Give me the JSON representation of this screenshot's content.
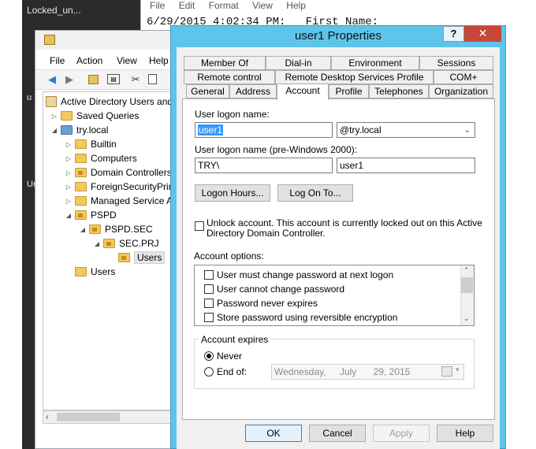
{
  "desktop": {
    "window_title": "Locked_un...",
    "letter_1": "u",
    "letter_2": "Ur"
  },
  "notepad": {
    "menu": [
      "File",
      "Edit",
      "Format",
      "View",
      "Help"
    ],
    "text": "6/29/2015 4:02:34 PM:   First Name:"
  },
  "aduc": {
    "menu": [
      "File",
      "Action",
      "View",
      "Help"
    ],
    "tree": [
      "Active Directory Users and",
      "Saved Queries",
      "try.local",
      "Builtin",
      "Computers",
      "Domain Controllers",
      "ForeignSecurityPrin",
      "Managed Service A",
      "PSPD",
      "PSPD.SEC",
      "SEC.PRJ",
      "Users",
      "Users"
    ]
  },
  "dialog": {
    "title": "user1 Properties",
    "help_glyph": "?",
    "close_glyph": "✕",
    "tabs_row1": [
      "Member Of",
      "Dial-in",
      "Environment",
      "Sessions"
    ],
    "tabs_row2": [
      "Remote control",
      "Remote Desktop Services Profile",
      "COM+"
    ],
    "tabs_row3": [
      "General",
      "Address",
      "Account",
      "Profile",
      "Telephones",
      "Organization"
    ],
    "active_tab": "Account",
    "logon_name_label": "User logon name:",
    "logon_name_value": "user1",
    "domain_suffix": "@try.local",
    "pre2000_label": "User logon name (pre-Windows 2000):",
    "pre2000_domain": "TRY\\",
    "pre2000_user": "user1",
    "logon_hours_button": "Logon Hours...",
    "logon_to_button": "Log On To...",
    "unlock_line1": "Unlock account. This account is currently locked out on this Active",
    "unlock_line2": "Directory Domain Controller.",
    "account_options_label": "Account options:",
    "account_options": [
      "User must change password at next logon",
      "User cannot change password",
      "Password never expires",
      "Store password using reversible encryption"
    ],
    "account_expires_label": "Account expires",
    "never_label": "Never",
    "end_of_label": "End of:",
    "end_of_date": {
      "weekday": "Wednesday,",
      "month": "July",
      "day_year": "29, 2015"
    },
    "buttons": {
      "ok": "OK",
      "cancel": "Cancel",
      "apply": "Apply",
      "help": "Help"
    }
  }
}
